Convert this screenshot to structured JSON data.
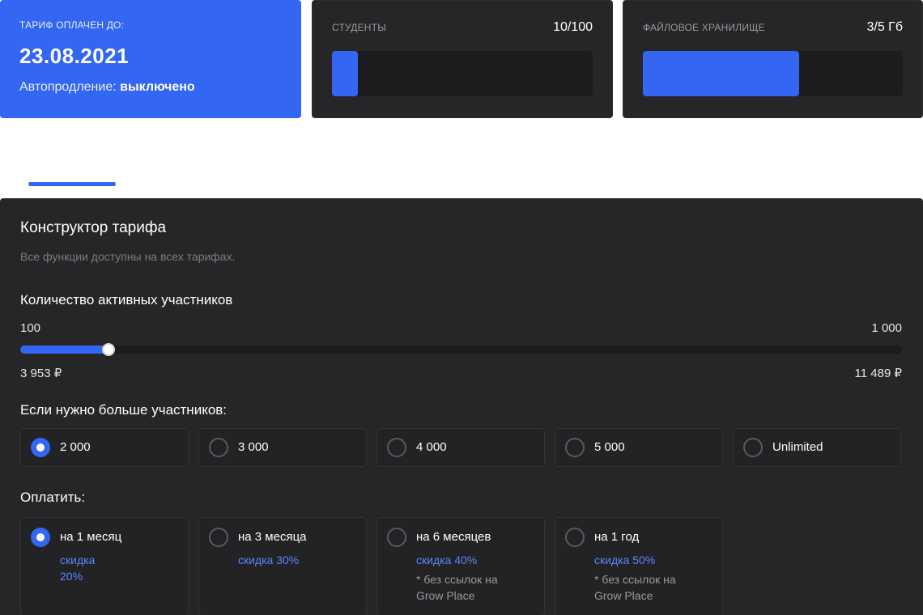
{
  "plan": {
    "label": "ТАРИФ ОПЛАЧЕН ДО:",
    "date": "23.08.2021",
    "autorenew_label": "Автопродление:",
    "autorenew_value": "выключено"
  },
  "students": {
    "label": "СТУДЕНТЫ",
    "count": "10/100",
    "fill_fraction": 0.1
  },
  "storage": {
    "label": "ФАЙЛОВОЕ ХРАНИЛИЩЕ",
    "count": "3/5 Гб",
    "fill_fraction": 0.6
  },
  "constructor": {
    "title": "Конструктор тарифа",
    "subtitle": "Все функции доступны на всех тарифах.",
    "participants_title": "Количество активных участников",
    "min_label": "100",
    "max_label": "1 000",
    "min_price": "3 953 ₽",
    "max_price": "11 489 ₽",
    "slider_fraction": 0.1,
    "more_title": "Если нужно больше участников:",
    "more_options": [
      {
        "label": "2 000",
        "selected": true
      },
      {
        "label": "3 000",
        "selected": false
      },
      {
        "label": "4 000",
        "selected": false
      },
      {
        "label": "5 000",
        "selected": false
      },
      {
        "label": "Unlimited",
        "selected": false
      }
    ],
    "pay_title": "Оплатить:",
    "pay_options": [
      {
        "label": "на 1 месяц",
        "discount": "скидка 20%",
        "note": "",
        "selected": true
      },
      {
        "label": "на 3 месяца",
        "discount": "скидка 30%",
        "note": "",
        "selected": false
      },
      {
        "label": "на 6 месяцев",
        "discount": "скидка 40%",
        "note": "* без ссылок на Grow Place",
        "selected": false
      },
      {
        "label": "на 1 год",
        "discount": "скидка 50%",
        "note": "* без ссылок на Grow Place",
        "selected": false
      }
    ]
  },
  "colors": {
    "accent": "#3366f2",
    "panel": "#262628",
    "discount": "#5a86ff"
  }
}
